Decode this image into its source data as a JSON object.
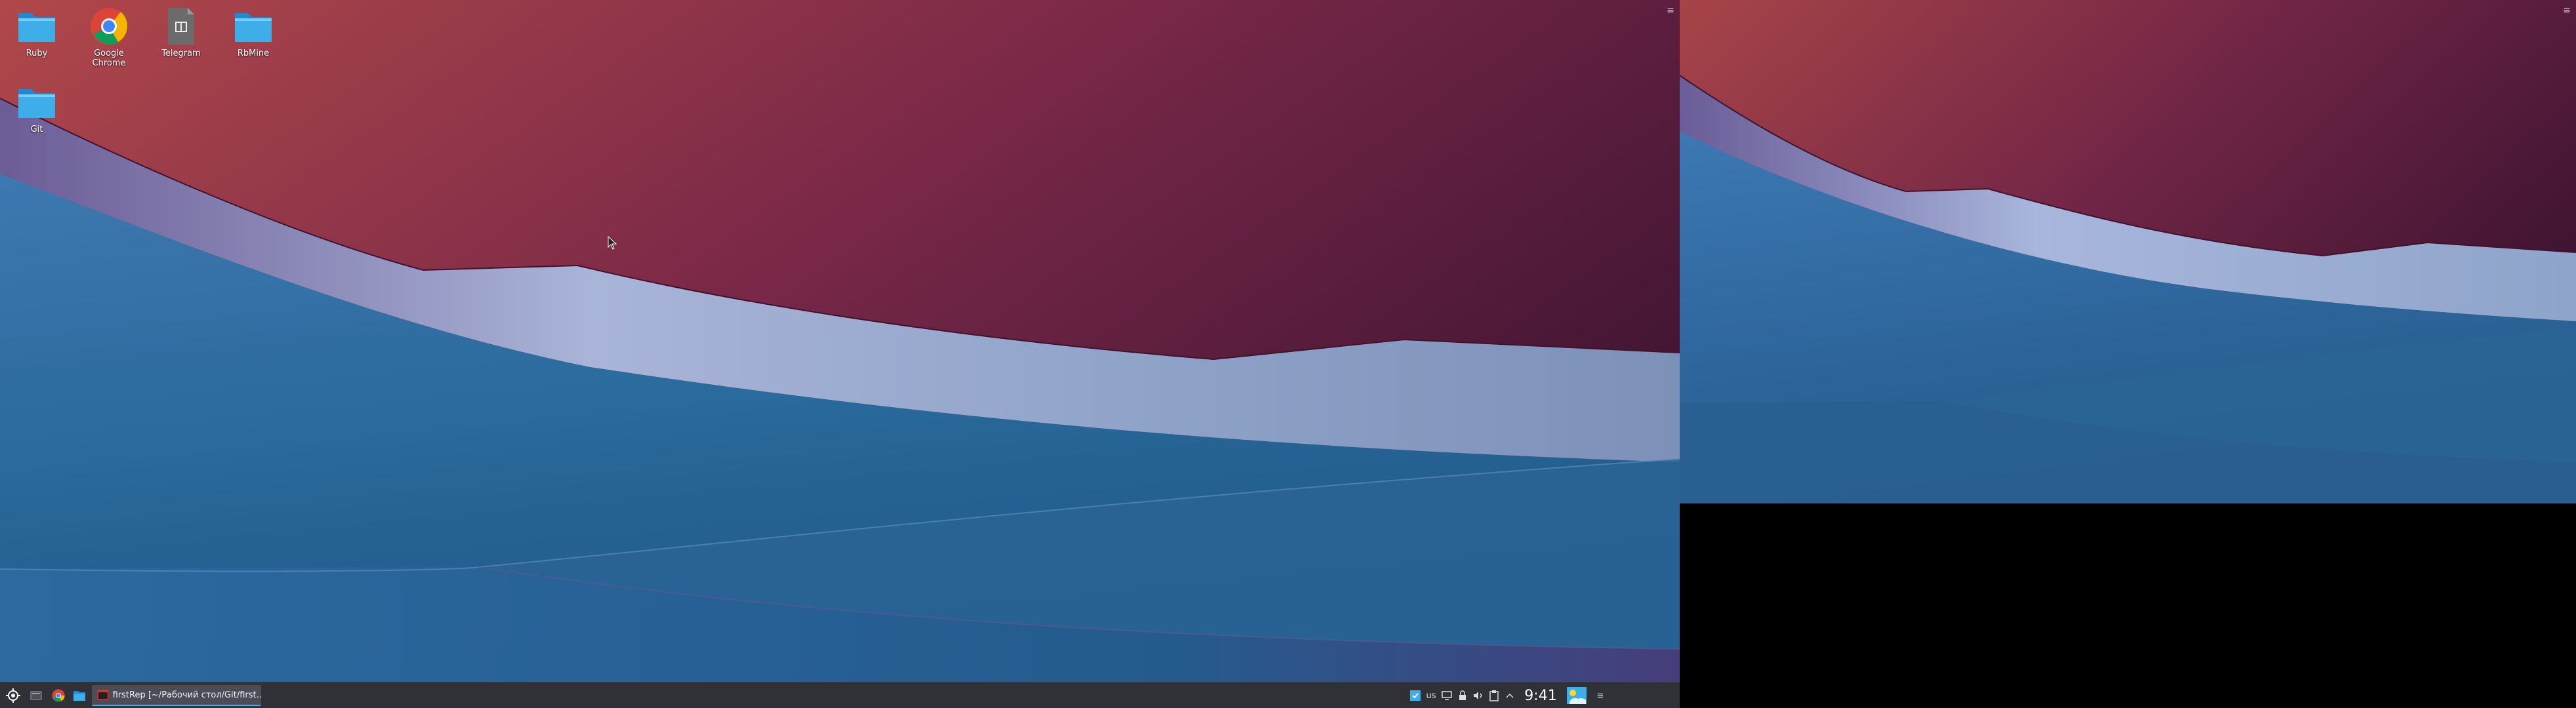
{
  "desktop": {
    "icons": [
      {
        "label": "Ruby",
        "icon": "folder-icon"
      },
      {
        "label": "Google Chrome",
        "icon": "chrome-icon"
      },
      {
        "label": "Telegram",
        "icon": "telegram-icon"
      },
      {
        "label": "RbMine",
        "icon": "folder-icon"
      },
      {
        "label": "Git",
        "icon": "folder-icon"
      }
    ],
    "menu_glyph": "≡"
  },
  "taskbar": {
    "launcher_icon": "kde-launcher-icon",
    "quick_launch": [
      "show-desktop-icon",
      "chrome-icon",
      "file-manager-icon"
    ],
    "task": {
      "label": "firstRep [~/Рабочий стол/Git/first...",
      "icon": "terminal-icon"
    },
    "tray": {
      "keyboard_layout": "us",
      "icons": [
        "updates-icon",
        "display-icon",
        "lock-icon",
        "volume-icon",
        "clipboard-icon",
        "tray-expand-icon"
      ],
      "clock": "9:41",
      "menu_glyph": "≡"
    }
  },
  "colors": {
    "taskbar_bg": "#2f3136",
    "task_active": "#3daee9",
    "sky_top": "#a64448",
    "sky_bottom": "#4e1c40",
    "sea": "#2a6a9a"
  }
}
